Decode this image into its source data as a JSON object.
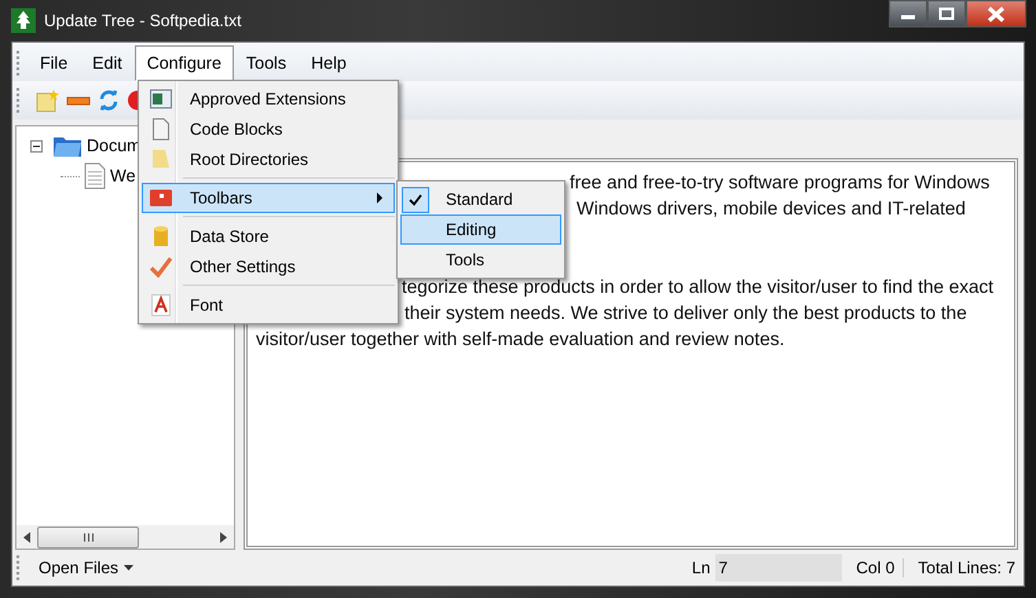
{
  "window": {
    "title": "Update Tree - Softpedia.txt"
  },
  "menubar": [
    {
      "label": "File",
      "selected": false
    },
    {
      "label": "Edit",
      "selected": false
    },
    {
      "label": "Configure",
      "selected": true
    },
    {
      "label": "Tools",
      "selected": false
    },
    {
      "label": "Help",
      "selected": false
    }
  ],
  "tree": {
    "items": [
      {
        "label": "Docum",
        "expanded": true,
        "children": [
          {
            "label": "We"
          }
        ]
      }
    ]
  },
  "editor": {
    "lines": [
      "free and free-to-try software programs for Windows",
      "Windows drivers, mobile devices and IT-related",
      "tegorize these products in order to allow the visitor/user to find the exact",
      "their system needs. We strive to deliver only the best products to the",
      "visitor/user together with self-made evaluation and review notes."
    ]
  },
  "menu": {
    "items": [
      {
        "label": "Approved Extensions",
        "selected": false,
        "separator_before": false,
        "submenu": false
      },
      {
        "label": "Code Blocks",
        "selected": false,
        "separator_before": false,
        "submenu": false
      },
      {
        "label": "Root Directories",
        "selected": false,
        "separator_before": false,
        "submenu": false
      },
      {
        "label": "Toolbars",
        "selected": true,
        "separator_before": true,
        "submenu": true
      },
      {
        "label": "Data Store",
        "selected": false,
        "separator_before": true,
        "submenu": false
      },
      {
        "label": "Other Settings",
        "selected": false,
        "separator_before": false,
        "submenu": false
      },
      {
        "label": "Font",
        "selected": false,
        "separator_before": true,
        "submenu": false
      }
    ]
  },
  "submenu": {
    "items": [
      {
        "label": "Standard",
        "checked": true,
        "selected": false
      },
      {
        "label": "Editing",
        "checked": false,
        "selected": true
      },
      {
        "label": "Tools",
        "checked": false,
        "selected": false
      }
    ]
  },
  "status_bar": {
    "open_files": "Open Files",
    "ln_label": "Ln",
    "ln_value": "7",
    "col": "Col 0",
    "total": "Total Lines: 7"
  }
}
